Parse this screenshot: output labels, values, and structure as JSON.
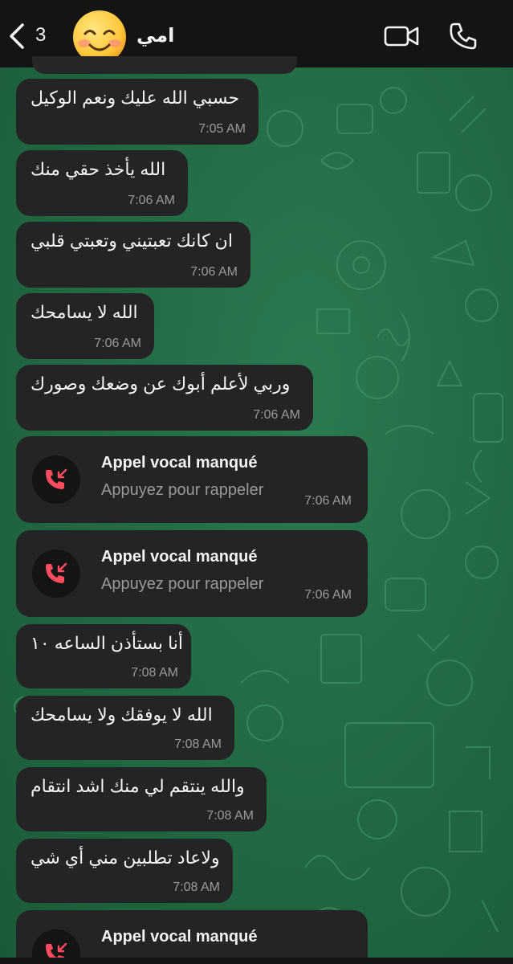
{
  "header": {
    "back_count": "3",
    "contact_name": "امي",
    "icons": {
      "back": "chevron-left-icon",
      "video": "video-camera-icon",
      "voice": "phone-icon"
    }
  },
  "messages": [
    {
      "text": "حسبي الله عليك ونعم الوكيل",
      "time": "7:05 AM"
    },
    {
      "text": "الله يأخذ حقي منك",
      "time": "7:06 AM"
    },
    {
      "text": "ان كانك تعبتيني وتعبتي قلبي",
      "time": "7:06 AM"
    },
    {
      "text": "الله لا يسامحك",
      "time": "7:06 AM"
    },
    {
      "text": "وربي لأعلم أبوك عن وضعك وصورك",
      "time": "7:06 AM"
    },
    {
      "title": "Appel vocal manqué",
      "subtitle": "Appuyez pour rappeler",
      "time": "7:06 AM"
    },
    {
      "title": "Appel vocal manqué",
      "subtitle": "Appuyez pour rappeler",
      "time": "7:06 AM"
    },
    {
      "text": "أنا بستأذن الساعه ١٠",
      "time": "7:08 AM"
    },
    {
      "text": "الله لا يوفقك ولا يسامحك",
      "time": "7:08 AM"
    },
    {
      "text": "والله ينتقم لي منك اشد انتقام",
      "time": "7:08 AM"
    },
    {
      "text": "ولاعاد تطلبين مني أي شي",
      "time": "7:08 AM"
    },
    {
      "title": "Appel vocal manqué",
      "subtitle": "",
      "time": ""
    }
  ],
  "colors": {
    "header_bg": "#141414",
    "chat_bg": "#236b45",
    "bubble_bg": "#242424",
    "missed_call_red": "#ff4d5e",
    "link_white": "#f2f2f2"
  }
}
